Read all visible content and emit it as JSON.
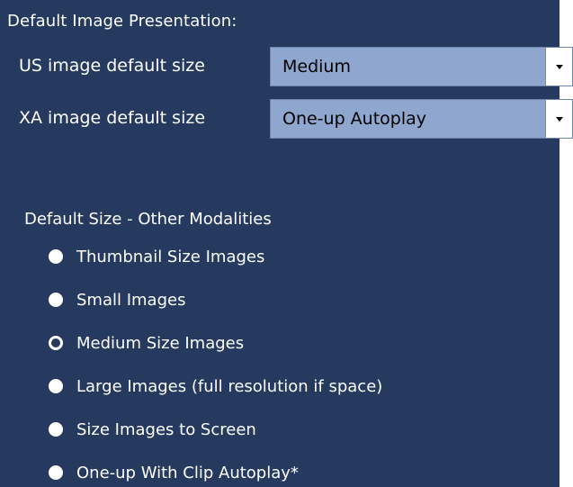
{
  "section": {
    "title": "Default Image Presentation:"
  },
  "us_size": {
    "label": "US image default size",
    "value": "Medium"
  },
  "xa_size": {
    "label": "XA image default size",
    "value": "One-up Autoplay"
  },
  "other_modalities": {
    "title": "Default Size - Other Modalities",
    "options": [
      {
        "label": "Thumbnail Size Images",
        "selected": false
      },
      {
        "label": "Small Images",
        "selected": false
      },
      {
        "label": "Medium Size Images",
        "selected": true
      },
      {
        "label": "Large Images (full resolution if space)",
        "selected": false
      },
      {
        "label": "Size Images to Screen",
        "selected": false
      },
      {
        "label": "One-up With Clip Autoplay*",
        "selected": false
      }
    ]
  },
  "colors": {
    "panel_background": "#253a5e",
    "select_background": "#8fa6cf",
    "text": "#ffffff"
  }
}
